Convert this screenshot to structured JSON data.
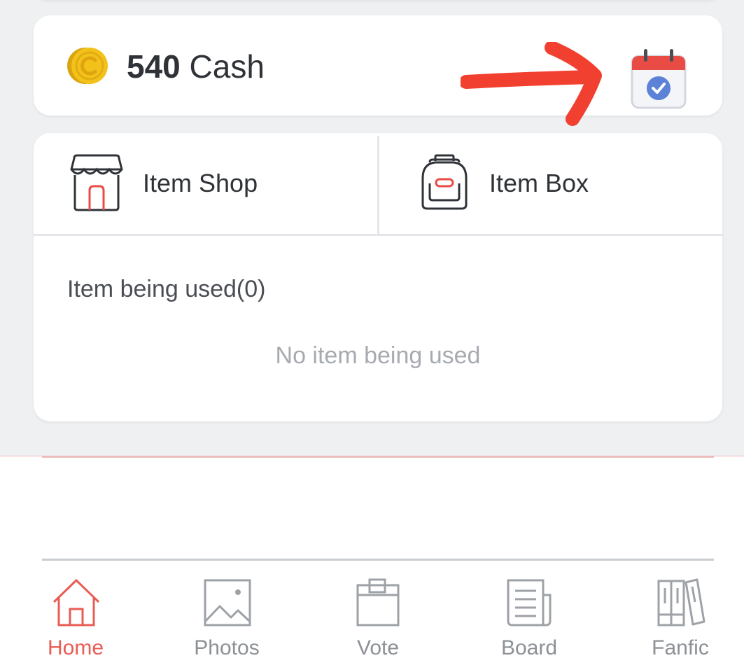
{
  "wallet": {
    "amount": "540",
    "currency": "Cash",
    "coin_icon": "coin-icon",
    "calendar_icon": "calendar-check-icon",
    "coin_color": "#f2c21b",
    "calendar_header_color": "#e84c45",
    "calendar_check_color": "#5b82d6"
  },
  "annotation": {
    "arrow_color": "#f24030"
  },
  "items": {
    "shop": {
      "label": "Item Shop",
      "icon": "shop-icon"
    },
    "box": {
      "label": "Item Box",
      "icon": "backpack-icon"
    },
    "used_title": "Item being used(0)",
    "used_empty": "No item being used"
  },
  "nav": {
    "accent": "#e85c54",
    "items": [
      {
        "label": "Home",
        "icon": "home-icon",
        "active": true
      },
      {
        "label": "Photos",
        "icon": "photo-icon",
        "active": false
      },
      {
        "label": "Vote",
        "icon": "ballot-box-icon",
        "active": false
      },
      {
        "label": "Board",
        "icon": "document-icon",
        "active": false
      },
      {
        "label": "Fanfic",
        "icon": "books-icon",
        "active": false
      }
    ]
  }
}
